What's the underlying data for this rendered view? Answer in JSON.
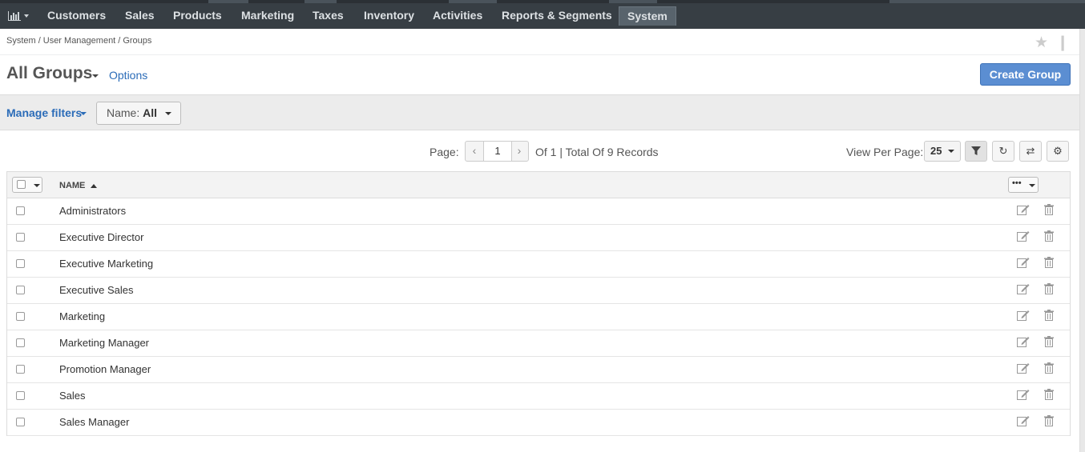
{
  "nav": {
    "items": [
      "Customers",
      "Sales",
      "Products",
      "Marketing",
      "Taxes",
      "Inventory",
      "Activities",
      "Reports & Segments",
      "System"
    ],
    "active": "System"
  },
  "breadcrumb": [
    "System",
    "/",
    "User Management",
    "/",
    "Groups"
  ],
  "page": {
    "title": "All Groups",
    "options_label": "Options",
    "create_label": "Create Group"
  },
  "filters": {
    "manage_label": "Manage filters",
    "name_label": "Name:",
    "name_value": "All"
  },
  "pagination": {
    "page_label": "Page:",
    "current_page": "1",
    "total_text": "Of 1 | Total Of 9 Records",
    "view_per_page_label": "View Per Page:",
    "per_page": "25"
  },
  "table": {
    "column_name": "NAME",
    "actions_label": "•••",
    "rows": [
      "Administrators",
      "Executive Director",
      "Executive Marketing",
      "Executive Sales",
      "Marketing",
      "Marketing Manager",
      "Promotion Manager",
      "Sales",
      "Sales Manager"
    ]
  },
  "colors": {
    "nav_bg": "#373e44",
    "accent": "#5b8ed2",
    "link": "#2b6cb8"
  },
  "icons": [
    "chart-icon",
    "star-icon",
    "pin-icon",
    "filter-icon",
    "refresh-icon",
    "reset-icon",
    "gear-icon",
    "edit-icon",
    "delete-icon"
  ]
}
